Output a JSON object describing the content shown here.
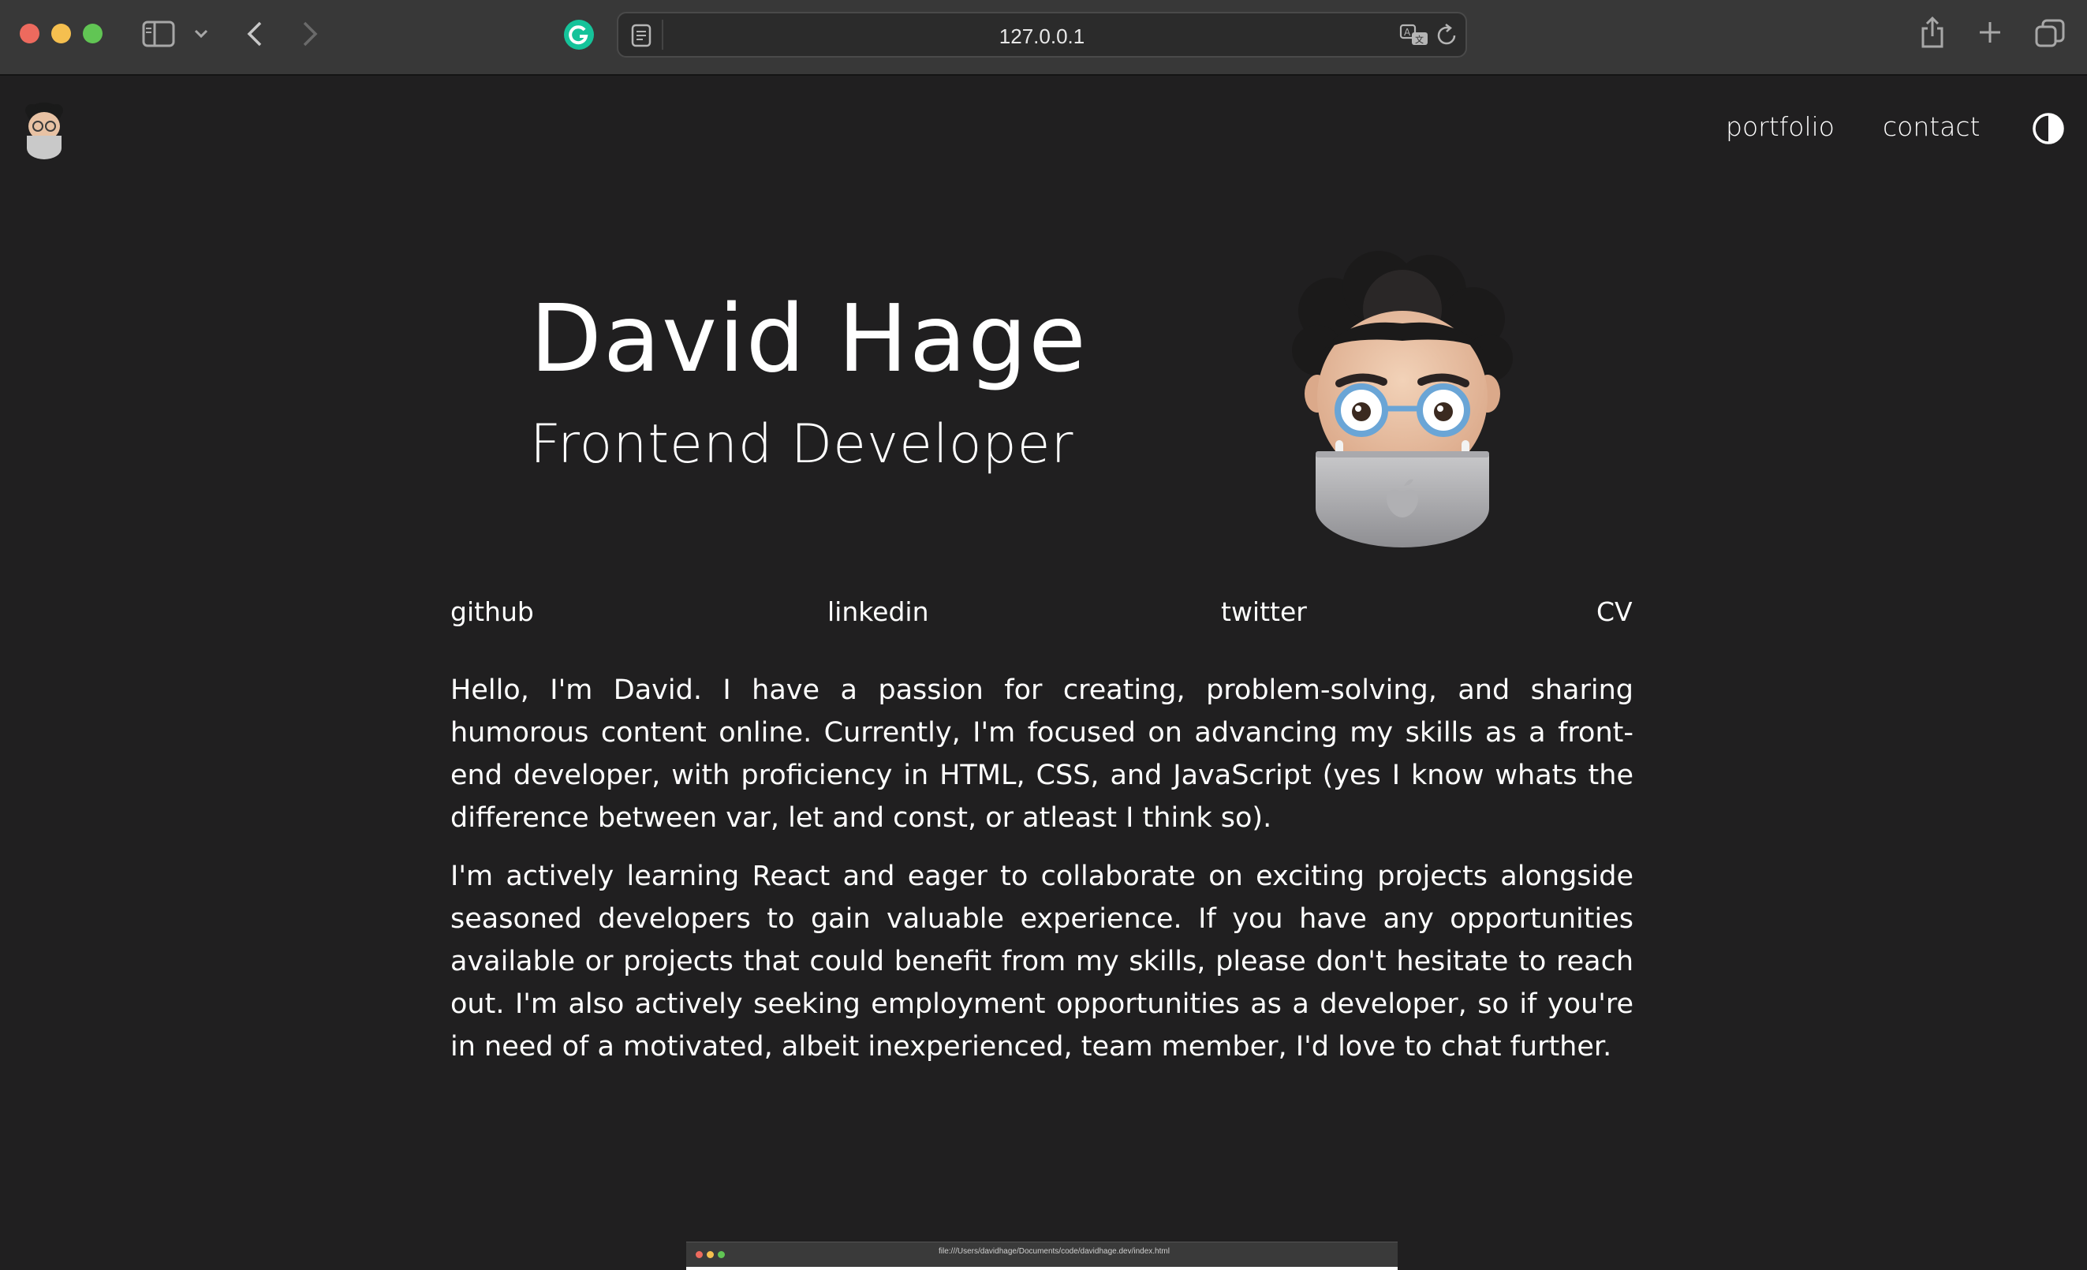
{
  "browser": {
    "url": "127.0.0.1",
    "icons": [
      "sidebar-icon",
      "chevron-down-icon",
      "back-icon",
      "forward-icon",
      "grammarly-icon",
      "reader-icon",
      "translate-icon",
      "reload-icon",
      "share-icon",
      "new-tab-icon",
      "tab-overview-icon"
    ]
  },
  "nav": {
    "portfolio": "portfolio",
    "contact": "contact",
    "theme_toggle_icon": "contrast-icon"
  },
  "hero": {
    "name": "David Hage",
    "role": "Frontend Developer",
    "avatar_icon": "memoji-avatar"
  },
  "social": {
    "github": "github",
    "linkedin": "linkedin",
    "twitter": "twitter",
    "cv": "CV"
  },
  "bio": {
    "p1": "Hello, I'm David. I have a passion for creating, problem-solving, and sharing humorous content online. Currently, I'm focused on advancing my skills as a front-end developer, with proficiency in HTML, CSS, and JavaScript (yes I know whats the difference between var, let and const, or atleast I think so).",
    "p2": "I'm actively learning React and eager to collaborate on exciting projects alongside seasoned developers to gain valuable experience. If you have any opportunities available or projects that could benefit from my skills, please don't hesitate to reach out. I'm also actively seeking employment opportunities as a developer, so if you're in need of a motivated, albeit inexperienced, team member, I'd love to chat further."
  },
  "thumbnail": {
    "url": "file:///Users/davidhage/Documents/code/davidhage.dev/index.html"
  },
  "colors": {
    "page_bg": "#201f20",
    "toolbar_bg": "#383838",
    "text": "#ffffff",
    "grammarly": "#15c39a"
  }
}
